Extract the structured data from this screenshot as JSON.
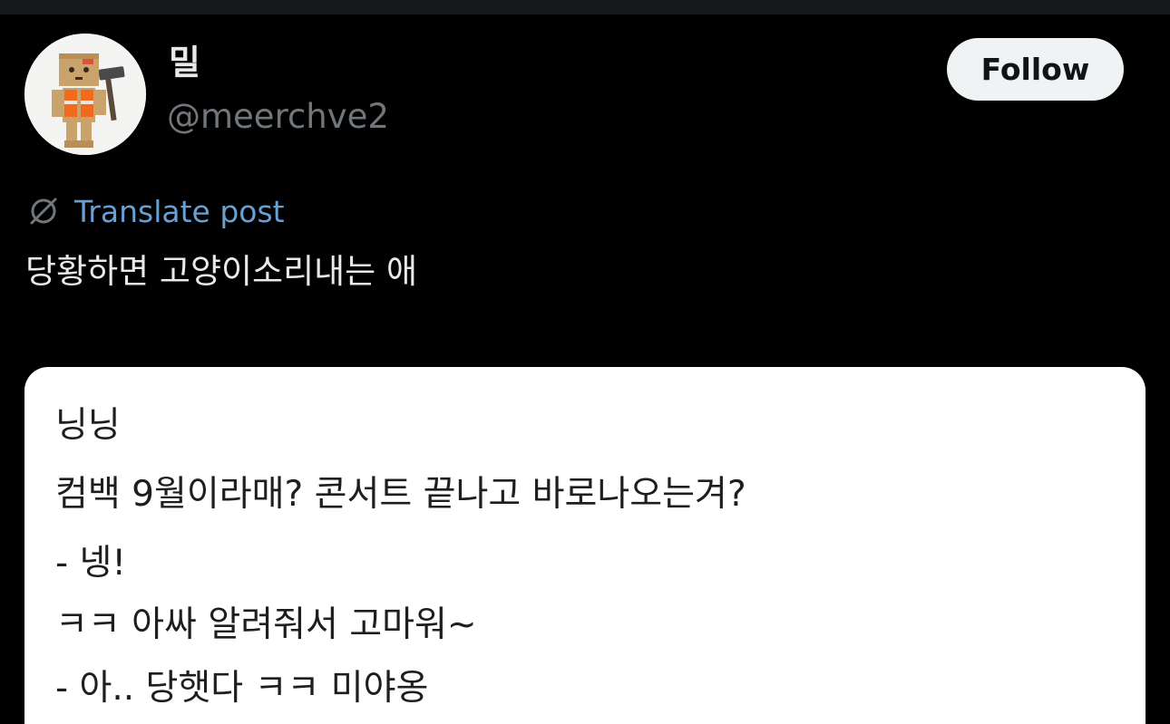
{
  "post": {
    "author": {
      "display_name": "밀",
      "handle": "@meerchve2",
      "avatar_icon": "cardboard-box-robot-avatar"
    },
    "follow_label": "Follow",
    "translate": {
      "icon": "translate-globe-icon",
      "label": "Translate post"
    },
    "text": "당황하면 고양이소리내는 애"
  },
  "media": {
    "lines": [
      "닝닝",
      "컴백 9월이라매? 콘서트 끝나고 바로나오는겨?",
      "- 넹!",
      "ㅋㅋ 아싸 알려줘서 고마워~",
      "- 아.. 당햇다 ㅋㅋ 미야옹"
    ]
  },
  "colors": {
    "background": "#000000",
    "text_primary": "#e7e9ea",
    "text_secondary": "#71767b",
    "link": "#6a9fd3",
    "follow_bg": "#eff3f4",
    "card_bg": "#ffffff"
  }
}
